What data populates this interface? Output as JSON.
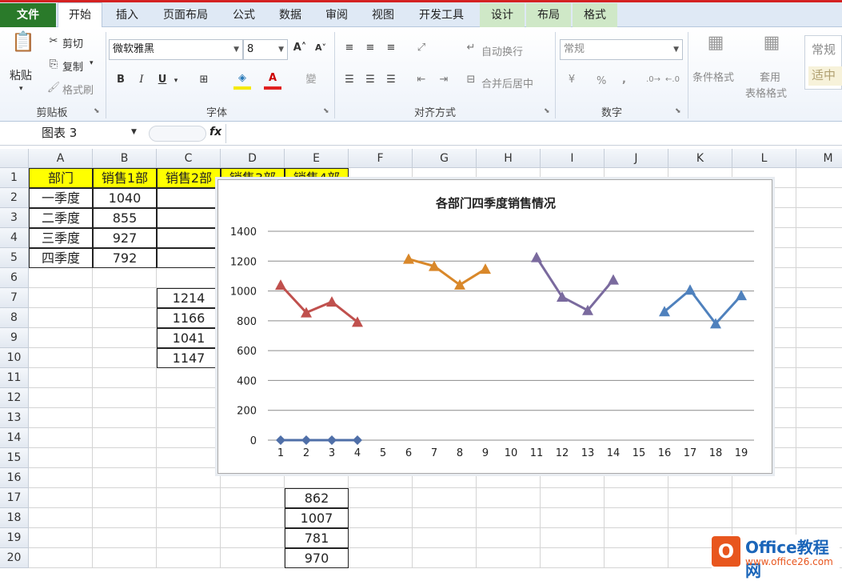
{
  "tabs": [
    "文件",
    "开始",
    "插入",
    "页面布局",
    "公式",
    "数据",
    "审阅",
    "视图",
    "开发工具",
    "设计",
    "布局",
    "格式"
  ],
  "active_tab": "开始",
  "clipboard": {
    "paste": "粘贴",
    "cut": "剪切",
    "copy": "复制",
    "format_painter": "格式刷",
    "label": "剪贴板"
  },
  "font": {
    "name": "微软雅黑",
    "size": "8",
    "label": "字体",
    "bold": "B",
    "italic": "I",
    "underline": "U"
  },
  "alignment": {
    "wrap": "自动换行",
    "merge": "合并后居中",
    "label": "对齐方式"
  },
  "number": {
    "format": "常规",
    "percent": "%",
    "comma": ",",
    "label": "数字"
  },
  "styles": {
    "conditional": "条件格式",
    "table_format_1": "套用",
    "table_format_2": "表格格式",
    "normal": "常规",
    "fit": "适中"
  },
  "name_box": "图表 3",
  "fx": "fx",
  "columns": [
    "A",
    "B",
    "C",
    "D",
    "E",
    "F",
    "G",
    "H",
    "I",
    "J",
    "K",
    "L",
    "M"
  ],
  "rows": [
    "1",
    "2",
    "3",
    "4",
    "5",
    "6",
    "7",
    "8",
    "9",
    "10",
    "11",
    "12",
    "13",
    "14",
    "15",
    "16",
    "17",
    "18",
    "19",
    "20"
  ],
  "cells": {
    "A1": "部门",
    "B1": "销售1部",
    "C1": "销售2部",
    "D1": "销售3部",
    "E1": "销售4部",
    "A2": "一季度",
    "B2": "1040",
    "A3": "二季度",
    "B3": "855",
    "A4": "三季度",
    "B4": "927",
    "A5": "四季度",
    "B5": "792",
    "C7": "1214",
    "C8": "1166",
    "C9": "1041",
    "C10": "1147",
    "E17": "862",
    "E18": "1007",
    "E19": "781",
    "E20": "970"
  },
  "chart_data": {
    "type": "line",
    "title": "各部门四季度销售情况",
    "categories": [
      "1",
      "2",
      "3",
      "4",
      "5",
      "6",
      "7",
      "8",
      "9",
      "10",
      "11",
      "12",
      "13",
      "14",
      "15",
      "16",
      "17",
      "18",
      "19"
    ],
    "ylim": [
      0,
      1400
    ],
    "yticks": [
      "0",
      "200",
      "400",
      "600",
      "800",
      "1000",
      "1200",
      "1400"
    ],
    "grid": true,
    "series": [
      {
        "x": [
          1,
          2,
          3,
          4
        ],
        "values": [
          0,
          0,
          0,
          0
        ],
        "color": "#4f6fa8",
        "marker": "diamond"
      },
      {
        "x": [
          1,
          2,
          3,
          4
        ],
        "values": [
          1040,
          855,
          927,
          792
        ],
        "color": "#c0504d",
        "marker": "triangle"
      },
      {
        "x": [
          6,
          7,
          8,
          9
        ],
        "values": [
          1214,
          1166,
          1041,
          1147
        ],
        "color": "#d9882a",
        "marker": "triangle"
      },
      {
        "x": [
          11,
          12,
          13,
          14
        ],
        "values": [
          1225,
          960,
          870,
          1075
        ],
        "color": "#7a6a9e",
        "marker": "triangle"
      },
      {
        "x": [
          16,
          17,
          18,
          19
        ],
        "values": [
          862,
          1007,
          781,
          970
        ],
        "color": "#4f81bd",
        "marker": "triangle"
      }
    ]
  },
  "logo": {
    "mark": "O",
    "name": "Office教程网",
    "url": "www.office26.com"
  }
}
